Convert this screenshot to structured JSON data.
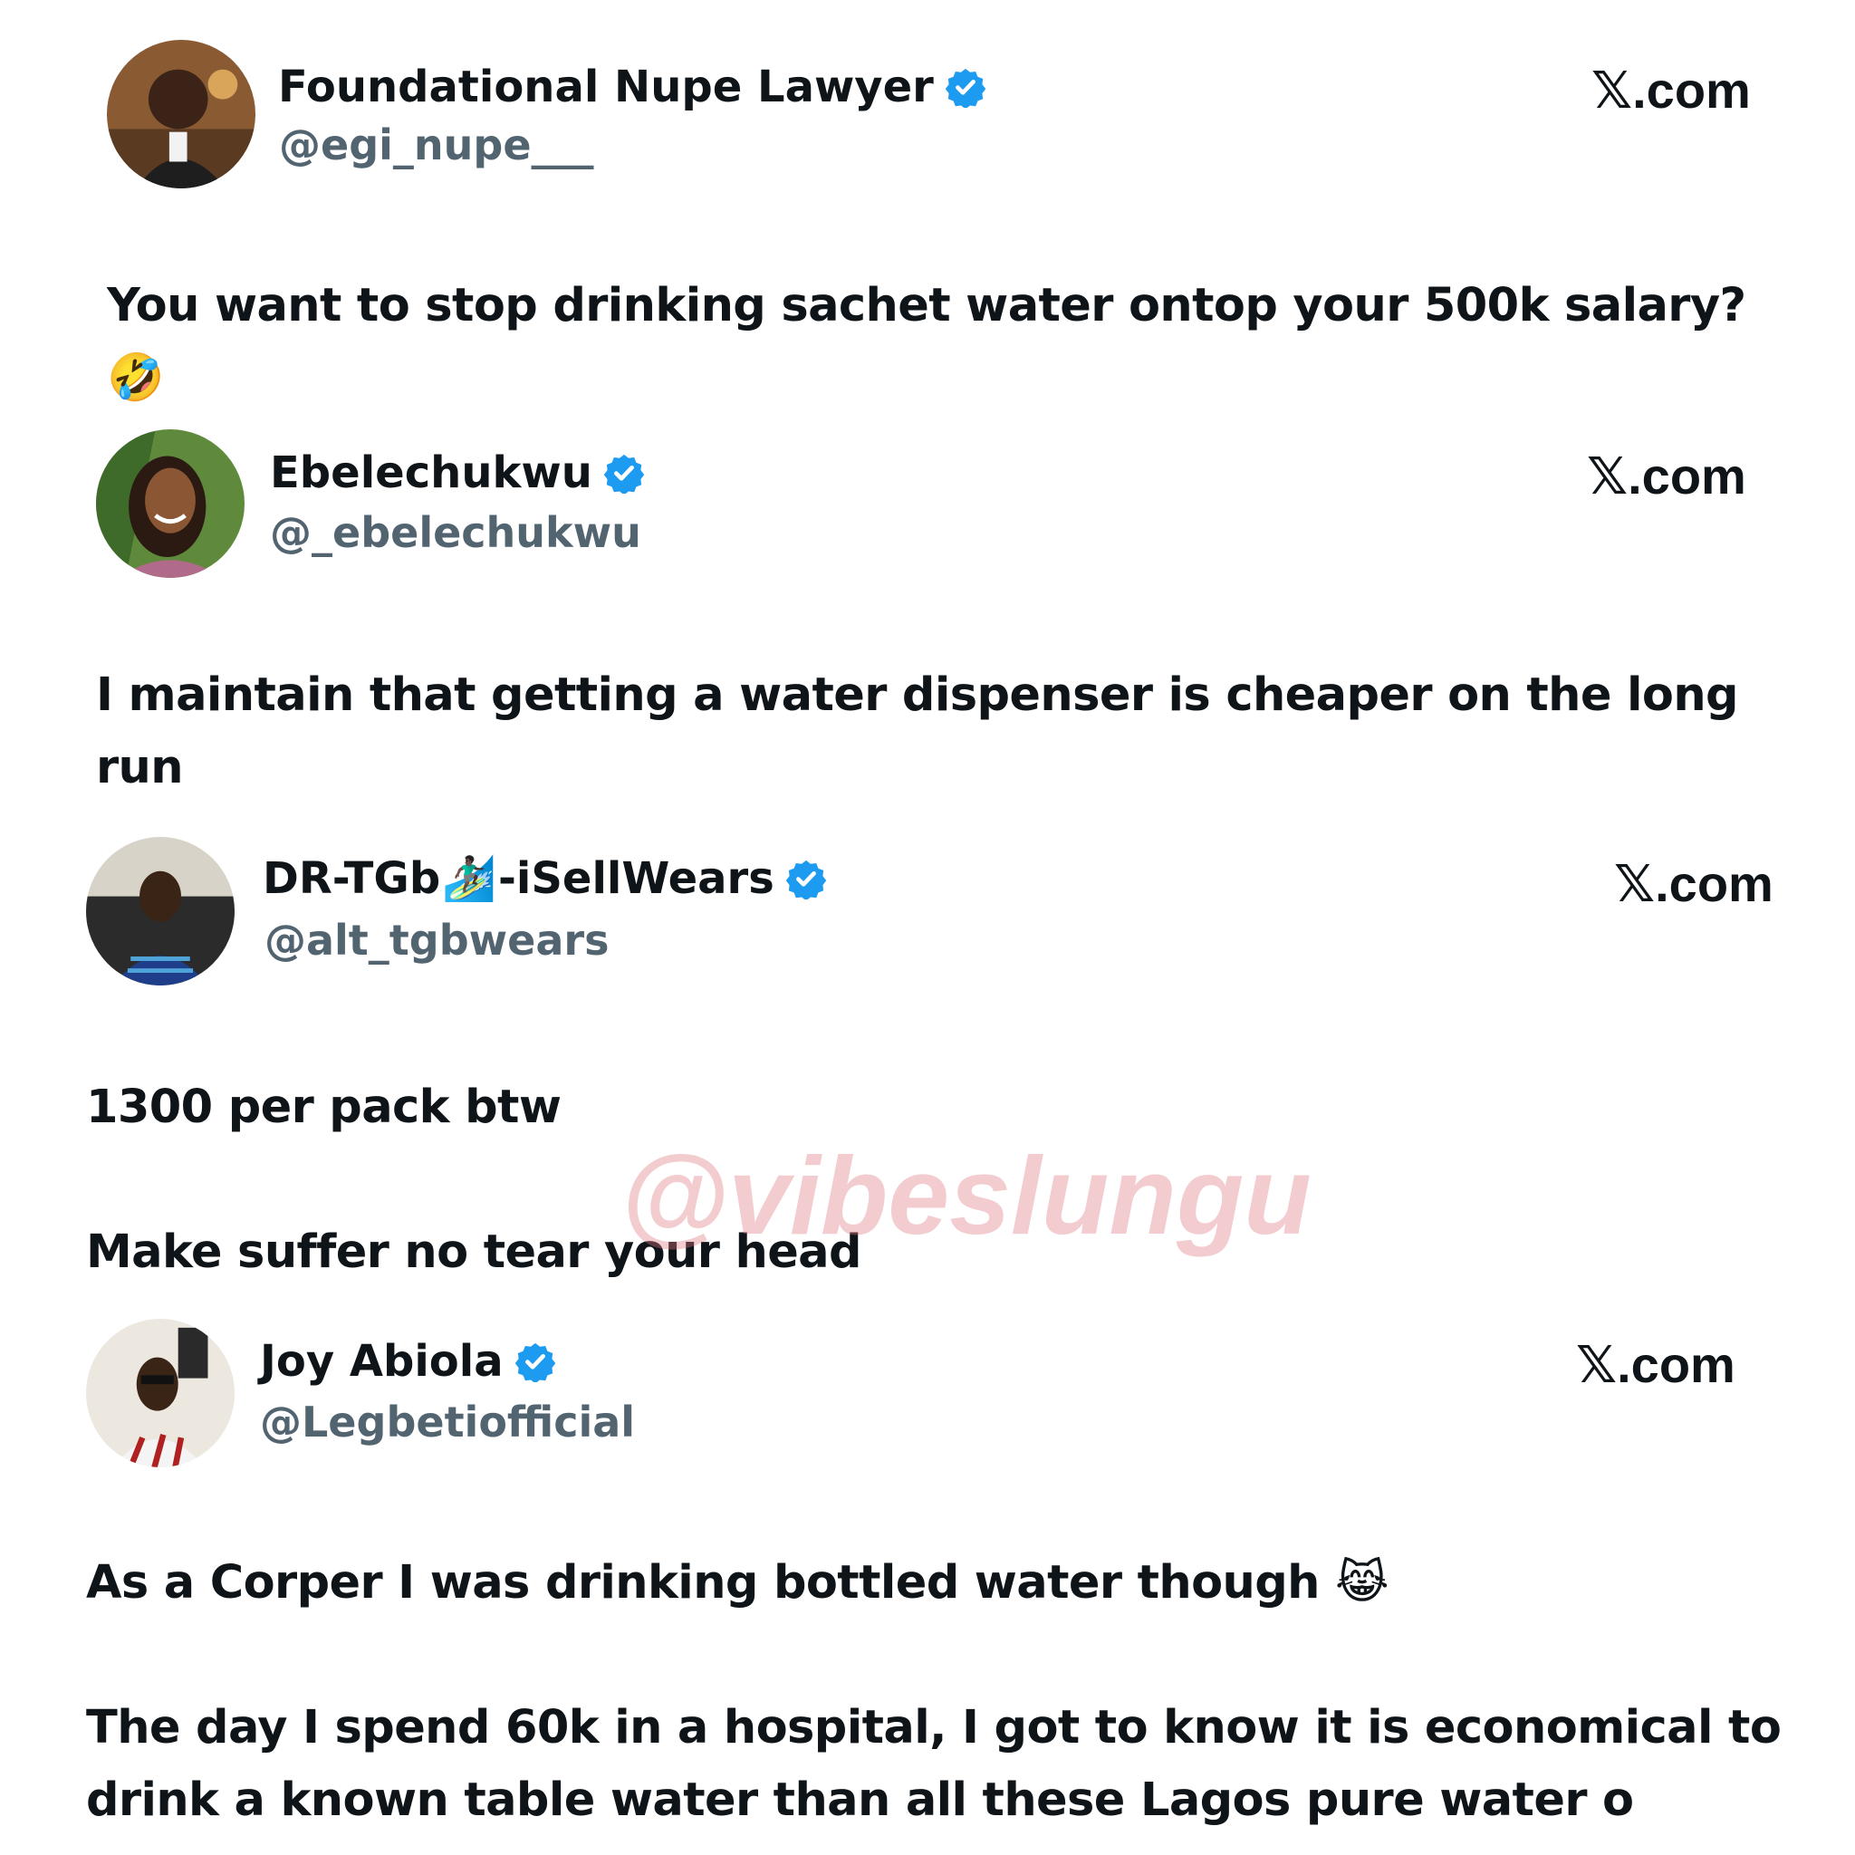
{
  "posts": [
    {
      "name": "Foundational Nupe Lawyer",
      "handle": "@egi_nupe___",
      "brand": "𝕏.com",
      "text": "You want to stop drinking sachet water ontop your 500k salary?\n🤣"
    },
    {
      "name": "Ebelechukwu",
      "handle": "@_ebelechukwu",
      "brand": "𝕏.com",
      "text": "I maintain that getting a water dispenser is cheaper on the long\nrun"
    },
    {
      "name_part1": "DR-TGb",
      "name_emoji": "🏄🏿‍♂️",
      "name_part2": "-iSellWears",
      "handle": "@alt_tgbwears",
      "brand": "𝕏.com",
      "text": "1300 per pack btw\n\nMake suffer no tear your head"
    },
    {
      "name": "Joy Abiola",
      "handle": "@Legbetiofficial",
      "brand": "𝕏.com",
      "text": "As a Corper I was drinking bottled water though 😹\n\nThe day I spend 60k in a hospital, I got to know it is economical to\ndrink a known table water than all these Lagos pure water o"
    }
  ],
  "watermark": "@vibeslungu",
  "colors": {
    "verified": "#1d9bf0",
    "handle": "#536471",
    "text": "#0f1419",
    "watermark": "#e07882"
  },
  "icons": {
    "verified": "verified-badge-icon"
  }
}
